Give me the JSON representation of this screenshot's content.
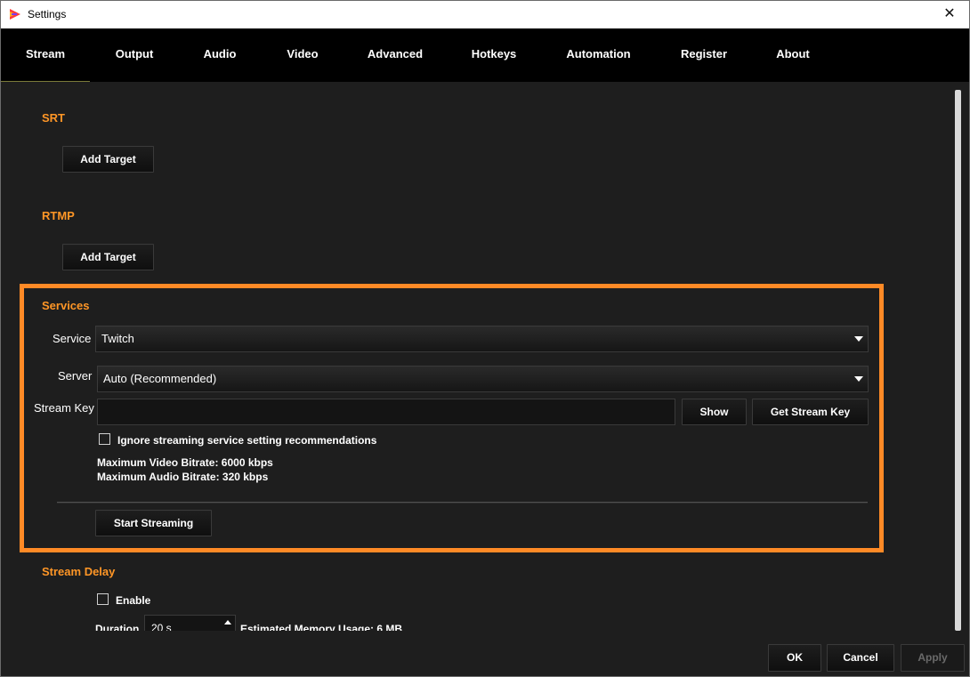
{
  "window": {
    "title": "Settings",
    "close_glyph": "✕"
  },
  "tabs": [
    {
      "label": "Stream",
      "active": true
    },
    {
      "label": "Output"
    },
    {
      "label": "Audio"
    },
    {
      "label": "Video"
    },
    {
      "label": "Advanced"
    },
    {
      "label": "Hotkeys"
    },
    {
      "label": "Automation"
    },
    {
      "label": "Register"
    },
    {
      "label": "About"
    }
  ],
  "srt": {
    "title": "SRT",
    "add_target_label": "Add Target"
  },
  "rtmp": {
    "title": "RTMP",
    "add_target_label": "Add Target"
  },
  "services": {
    "title": "Services",
    "service_label": "Service",
    "service_value": "Twitch",
    "server_label": "Server",
    "server_value": "Auto (Recommended)",
    "stream_key_label": "Stream Key",
    "stream_key_value": "",
    "show_label": "Show",
    "get_stream_key_label": "Get Stream Key",
    "ignore_label": "Ignore streaming service setting recommendations",
    "ignore_checked": false,
    "max_video_bitrate": "Maximum Video Bitrate: 6000 kbps",
    "max_audio_bitrate": "Maximum Audio Bitrate: 320 kbps",
    "start_streaming_label": "Start Streaming"
  },
  "stream_delay": {
    "title": "Stream Delay",
    "enable_label": "Enable",
    "enable_checked": false,
    "duration_label": "Duration",
    "duration_value": "20 s",
    "memory_usage": "Estimated Memory Usage: 6 MB"
  },
  "footer": {
    "ok_label": "OK",
    "cancel_label": "Cancel",
    "apply_label": "Apply"
  },
  "colors": {
    "accent": "#ff9626",
    "highlight_border": "#ff8a26",
    "tab_bar": "#000000",
    "background": "#1e1e1e"
  },
  "icons": {
    "app": "app-logo-icon",
    "close": "close-icon",
    "dropdown": "caret-down-icon",
    "spin_up": "spin-up-icon"
  }
}
